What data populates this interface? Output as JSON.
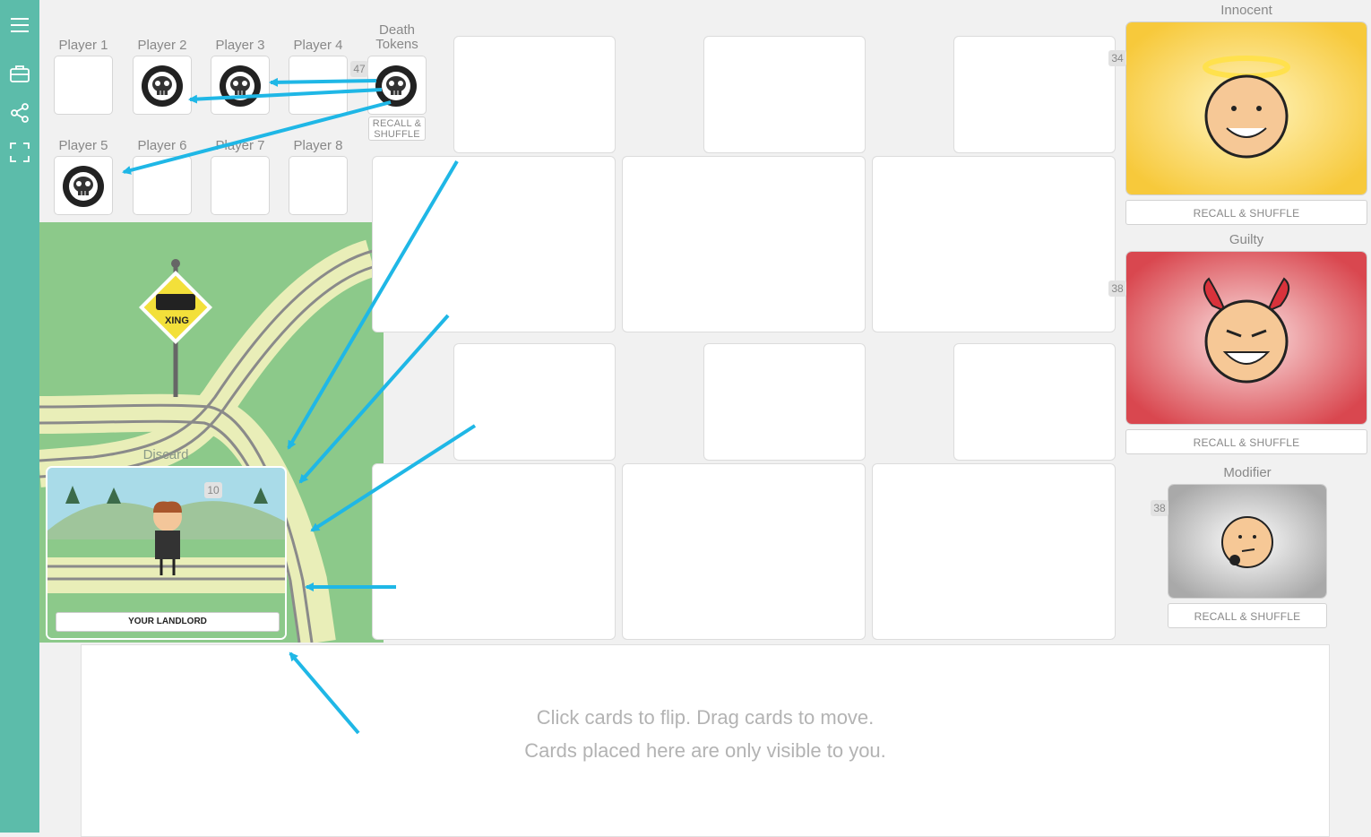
{
  "sidebar": {
    "icons": [
      "menu-icon",
      "briefcase-icon",
      "share-icon",
      "fullscreen-icon"
    ]
  },
  "players": {
    "labels": [
      "Player 1",
      "Player 2",
      "Player 3",
      "Player 4",
      "Player 5",
      "Player 6",
      "Player 7",
      "Player 8"
    ]
  },
  "death_tokens": {
    "label_line1": "Death",
    "label_line2": "Tokens",
    "count": "47",
    "recall_line1": "RECALL &",
    "recall_line2": "SHUFFLE"
  },
  "discard": {
    "label": "Discard",
    "count": "10",
    "card_caption": "YOUR LANDLORD",
    "sign_text": "XING"
  },
  "decks": {
    "innocent": {
      "label": "Innocent",
      "count": "34",
      "button": "RECALL & SHUFFLE"
    },
    "guilty": {
      "label": "Guilty",
      "count": "38",
      "button": "RECALL & SHUFFLE"
    },
    "modifier": {
      "label": "Modifier",
      "count": "38",
      "button": "RECALL & SHUFFLE"
    }
  },
  "hand": {
    "line1": "Click cards to flip.   Drag cards to move.",
    "line2": "Cards placed here are only visible to you."
  },
  "colors": {
    "sidebar": "#5cbcaa",
    "arrow": "#1fb7e6",
    "grass": "#8cc98a",
    "innocent_bg": "#f7c93b",
    "guilty_bg": "#d9474f",
    "modifier_bg": "#a9a9a9"
  }
}
